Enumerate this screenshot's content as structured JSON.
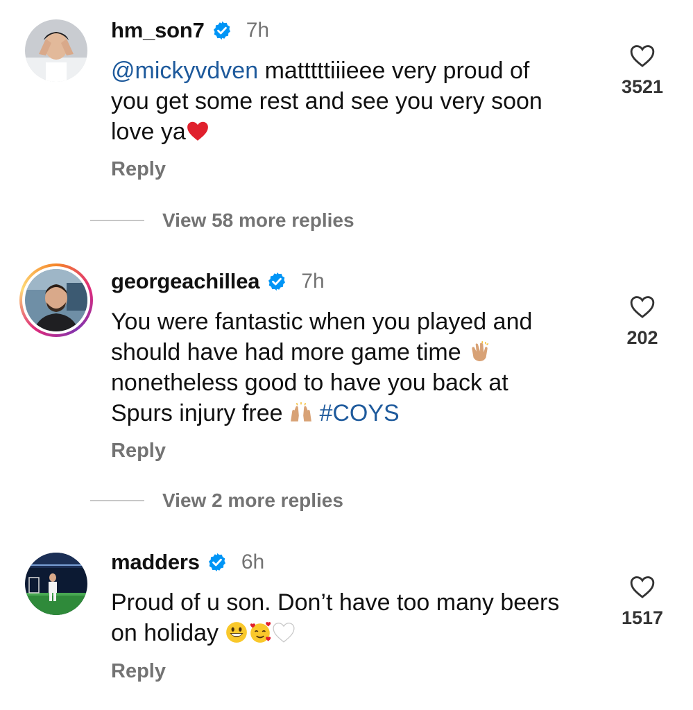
{
  "comments": [
    {
      "username": "hm_son7",
      "time": "7h",
      "mention": "@mickyvdven",
      "text_line1": " matttttiiieee very proud of",
      "text_line2": "you get some rest and see you very soon",
      "text_line3": "love ya",
      "reply_label": "Reply",
      "likes": "3521",
      "view_replies": "View 58 more replies"
    },
    {
      "username": "georgeachillea",
      "time": "7h",
      "text_line1": "You were fantastic when you played and",
      "text_line2": "should have had more game time",
      "text_line3": "nonetheless good to have you back at",
      "text_line4": "Spurs injury free",
      "hashtag": "#COYS",
      "reply_label": "Reply",
      "likes": "202",
      "view_replies": "View 2 more replies"
    },
    {
      "username": "madders",
      "time": "6h",
      "text_line1": "Proud of u son. Don’t have too many beers",
      "text_line2": "on holiday",
      "reply_label": "Reply",
      "likes": "1517"
    }
  ],
  "colors": {
    "link": "#1e5a9c",
    "verified": "#0095f6",
    "muted": "#737373"
  },
  "icons": [
    "verified-badge-icon",
    "heart-outline-icon",
    "red-heart-emoji",
    "clapping-hands-emoji",
    "raising-hands-emoji",
    "grinning-face-emoji",
    "smiling-face-with-hearts-emoji",
    "white-heart-emoji"
  ]
}
